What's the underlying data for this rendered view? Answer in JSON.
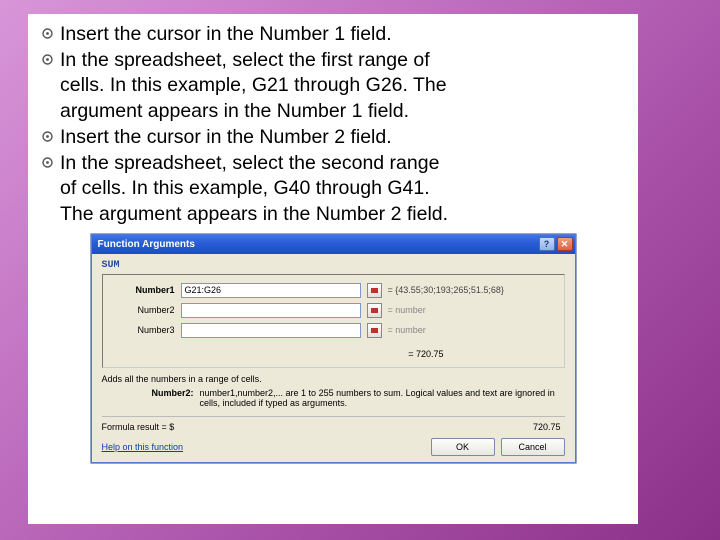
{
  "bullets": {
    "p1": "Insert the cursor in the Number 1 field.",
    "p2a": "In the spreadsheet, select the first range of",
    "p2b": "cells. In this example, G21 through G26. The",
    "p2c": "argument appears in the Number 1 field.",
    "p3": "Insert the cursor in the Number 2 field.",
    "p4a": "In the spreadsheet, select the second range",
    "p4b": "of cells. In this example, G40 through G41.",
    "p4c": "The argument appears in the Number 2 field."
  },
  "dialog": {
    "title": "Function Arguments",
    "func": "SUM",
    "args": [
      {
        "label": "Number1",
        "value": "G21:G26",
        "preview": "= {43.55;30;193;265;51.5;68}"
      },
      {
        "label": "Number2",
        "value": "",
        "preview": "= number"
      },
      {
        "label": "Number3",
        "value": "",
        "preview": "= number"
      }
    ],
    "result_inline": "= 720.75",
    "description": "Adds all the numbers in a range of cells.",
    "argdesc_label": "Number2:",
    "argdesc_text": "number1,number2,... are 1 to 255 numbers to sum. Logical values and text are ignored in cells, included if typed as arguments.",
    "formula_label": "Formula result = $",
    "formula_value": "720.75",
    "help": "Help on this function",
    "ok": "OK",
    "cancel": "Cancel"
  }
}
